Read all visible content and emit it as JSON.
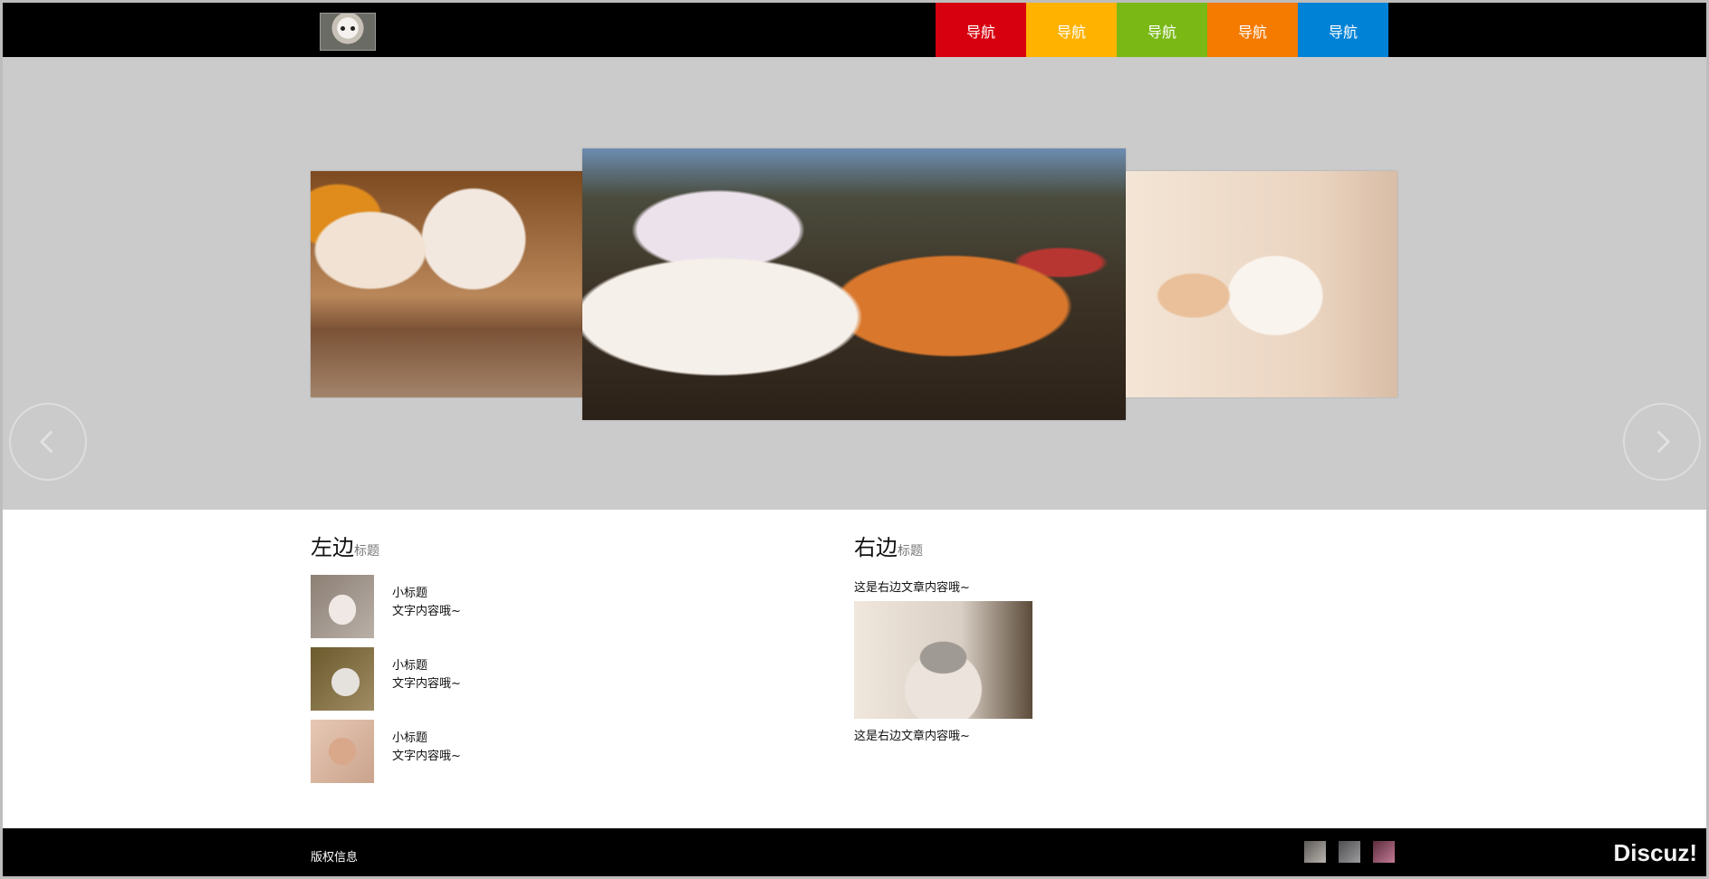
{
  "header": {
    "logo_icon": "cat-logo-icon",
    "nav": [
      {
        "label": "导航",
        "color": "#d7000f"
      },
      {
        "label": "导航",
        "color": "#ffb200"
      },
      {
        "label": "导航",
        "color": "#79b815"
      },
      {
        "label": "导航",
        "color": "#f47a00"
      },
      {
        "label": "导航",
        "color": "#0082d6"
      }
    ]
  },
  "carousel": {
    "prev_icon": "chevron-left-icon",
    "next_icon": "chevron-right-icon"
  },
  "left_section": {
    "title": "左边",
    "subtitle": "标题",
    "items": [
      {
        "title": "小标题",
        "text": "文字内容哦~"
      },
      {
        "title": "小标题",
        "text": "文字内容哦~"
      },
      {
        "title": "小标题",
        "text": "文字内容哦~"
      }
    ]
  },
  "right_section": {
    "title": "右边",
    "subtitle": "标题",
    "text_top": "这是右边文章内容哦~",
    "text_bottom": "这是右边文章内容哦~"
  },
  "footer": {
    "copyright": "版权信息",
    "brand": "Discuz!"
  }
}
